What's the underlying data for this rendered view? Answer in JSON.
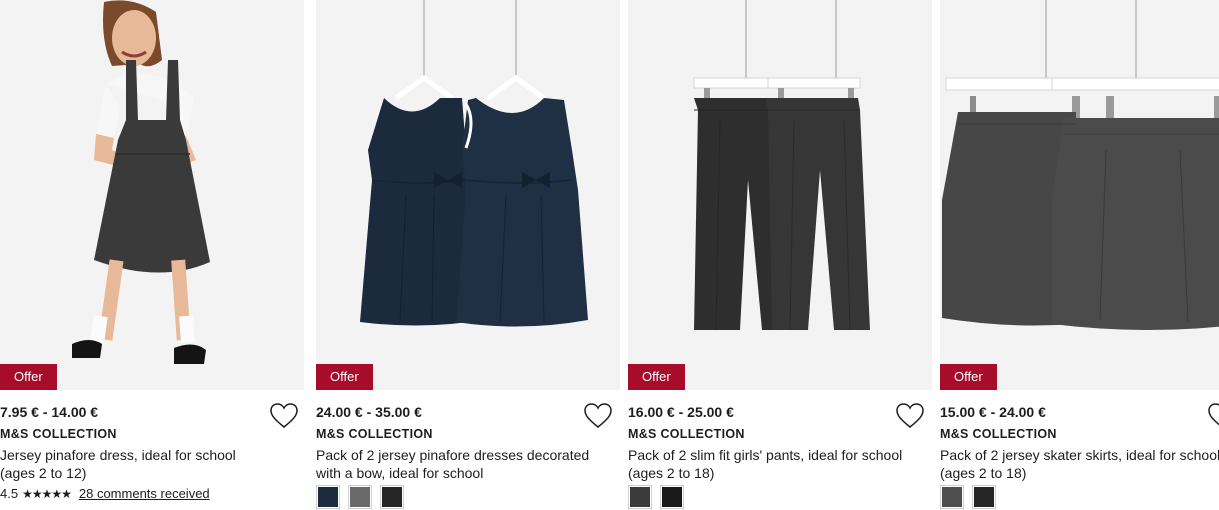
{
  "products": [
    {
      "offer": "Offer",
      "price": "24.00 € - 35.00 €",
      "brand": "M&S COLLECTION",
      "title": "Pack of 2 jersey pinafore dresses decorated with a bow, ideal for school",
      "swatches": [
        "#1c2b3e",
        "#6a6a6a",
        "#262626"
      ]
    },
    {
      "offer": "Offer",
      "price": "16.00 € - 25.00 €",
      "brand": "M&S COLLECTION",
      "title": "Pack of 2 slim fit girls' pants, ideal for school (ages 2 to 18)",
      "swatches": [
        "#3b3b3b",
        "#1a1a1a"
      ]
    },
    {
      "offer": "Offer",
      "price": "15.00 € - 24.00 €",
      "brand": "M&S COLLECTION",
      "title": "Pack of 2 jersey skater skirts, ideal for school (ages 2 to 18)",
      "swatches": [
        "#4e4e4e",
        "#262626"
      ]
    },
    {
      "offer": "Offer",
      "price": "7.95 € - 14.00 €",
      "brand": "M&S COLLECTION",
      "title": "Jersey pinafore dress, ideal for school (ages 2 to 12)",
      "rating": {
        "score": "4.5",
        "stars": "★★★★★",
        "stars_value": 4.5,
        "comments": "28 comments received"
      }
    }
  ],
  "colors": {
    "offer_badge": "#a70d2a",
    "navy_dress": "#1d2c40",
    "grey_garment": "#3c3c3c"
  }
}
